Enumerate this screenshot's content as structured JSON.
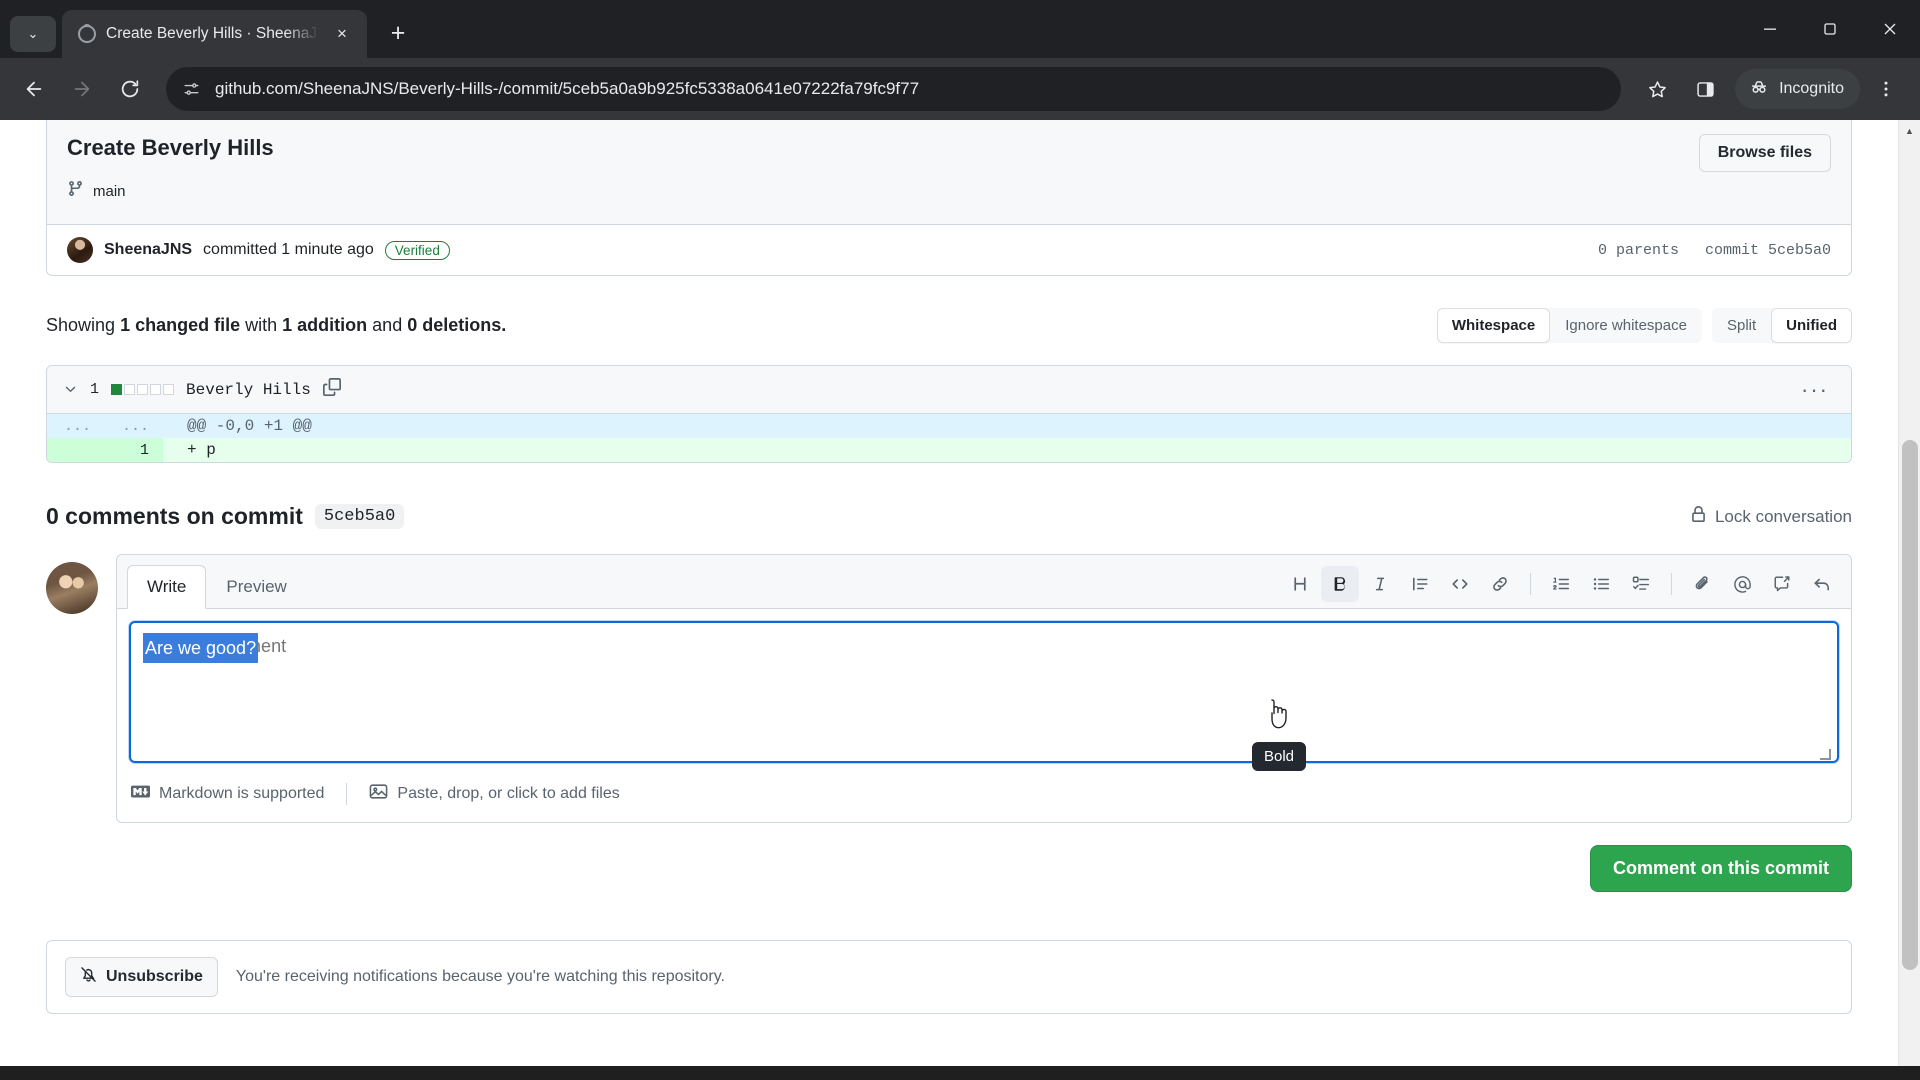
{
  "browser": {
    "tab": {
      "title": "Create Beverly Hills · SheenaJNS",
      "close_label": "×",
      "favicon": "github-favicon"
    },
    "new_tab_label": "+",
    "tab_search_label": "⌄",
    "url": "github.com/SheenaJNS/Beverly-Hills-/commit/5ceb5a0a9b925fc5338a0641e07222fa79fc9f77",
    "site_info_icon": "page-settings-icon",
    "back_label": "←",
    "forward_label": "→",
    "reload_label": "⟳",
    "bookmark_icon": "star-icon",
    "side_panel_icon": "side-panel-icon",
    "profile_label": "Incognito",
    "menu_icon": "three-dot-menu-icon",
    "window_minimize": "minimize-icon",
    "window_maximize": "maximize-icon",
    "window_close": "close-icon"
  },
  "commit": {
    "title": "Create Beverly Hills",
    "browse_files_label": "Browse files",
    "branch": "main",
    "author": "SheenaJNS",
    "committed_text": "committed 1 minute ago",
    "verified_label": "Verified",
    "parents": "0 parents",
    "commit_sha_label": "commit 5ceb5a0"
  },
  "diff": {
    "showing_prefix": "Showing",
    "changed_files": "1 changed file",
    "with_text": "with",
    "additions": "1 addition",
    "and_text": "and",
    "deletions": "0 deletions.",
    "whitespace_label": "Whitespace",
    "ignore_whitespace_label": "Ignore whitespace",
    "split_label": "Split",
    "unified_label": "Unified",
    "file": {
      "change_count": "1",
      "name": "Beverly Hills",
      "copy_icon": "copy-path-icon",
      "menu_icon": "kebab-menu-icon",
      "diffstat_squares": [
        "add",
        "none",
        "none",
        "none",
        "none"
      ]
    },
    "hunk": {
      "left_ln": "...",
      "right_ln": "...",
      "code": "@@ -0,0 +1 @@"
    },
    "lines": [
      {
        "ln": "1",
        "marker": "+",
        "code": "p"
      }
    ]
  },
  "comments": {
    "title": "0 comments on commit",
    "sha": "5ceb5a0",
    "lock_label": "Lock conversation",
    "lock_icon": "lock-icon"
  },
  "editor": {
    "write_tab": "Write",
    "preview_tab": "Preview",
    "textarea_value": "Are we good?",
    "textarea_placeholder": "Leave a comment",
    "toolbar": [
      {
        "name": "heading-icon",
        "glyph": "H",
        "tooltip": "Heading"
      },
      {
        "name": "bold-icon",
        "glyph": "B",
        "tooltip": "Bold"
      },
      {
        "name": "italic-icon",
        "glyph": "I",
        "tooltip": "Italic"
      },
      {
        "name": "quote-icon",
        "glyph": "quote",
        "tooltip": "Quote"
      },
      {
        "name": "code-icon",
        "glyph": "<>",
        "tooltip": "Code"
      },
      {
        "name": "link-icon",
        "glyph": "link",
        "tooltip": "Link"
      },
      {
        "name": "ordered-list-icon",
        "glyph": "ol",
        "tooltip": "Numbered list"
      },
      {
        "name": "unordered-list-icon",
        "glyph": "ul",
        "tooltip": "Unordered list"
      },
      {
        "name": "task-list-icon",
        "glyph": "task",
        "tooltip": "Task list"
      },
      {
        "name": "attach-files-icon",
        "glyph": "clip",
        "tooltip": "Attach files"
      },
      {
        "name": "mention-icon",
        "glyph": "@",
        "tooltip": "Mention"
      },
      {
        "name": "saved-replies-icon",
        "glyph": "reply-box",
        "tooltip": "Reference in new issue"
      },
      {
        "name": "reply-icon",
        "glyph": "↩",
        "tooltip": "Reply"
      }
    ],
    "active_tooltip": "Bold",
    "markdown_hint": "Markdown is supported",
    "markdown_icon": "markdown-icon",
    "attach_hint": "Paste, drop, or click to add files",
    "attach_icon": "image-icon",
    "submit_label": "Comment on this commit",
    "submit_color": "#2da44e"
  },
  "notifications": {
    "unsubscribe_label": "Unsubscribe",
    "bell_icon": "bell-slash-icon",
    "text": "You're receiving notifications because you're watching this repository."
  },
  "colors": {
    "accent": "#0969da",
    "green": "#2da44e",
    "addition_bg": "#e6ffec",
    "hunk_bg": "#ddf4ff",
    "verified": "#1a7f37",
    "selection": "#3b7ddd"
  }
}
